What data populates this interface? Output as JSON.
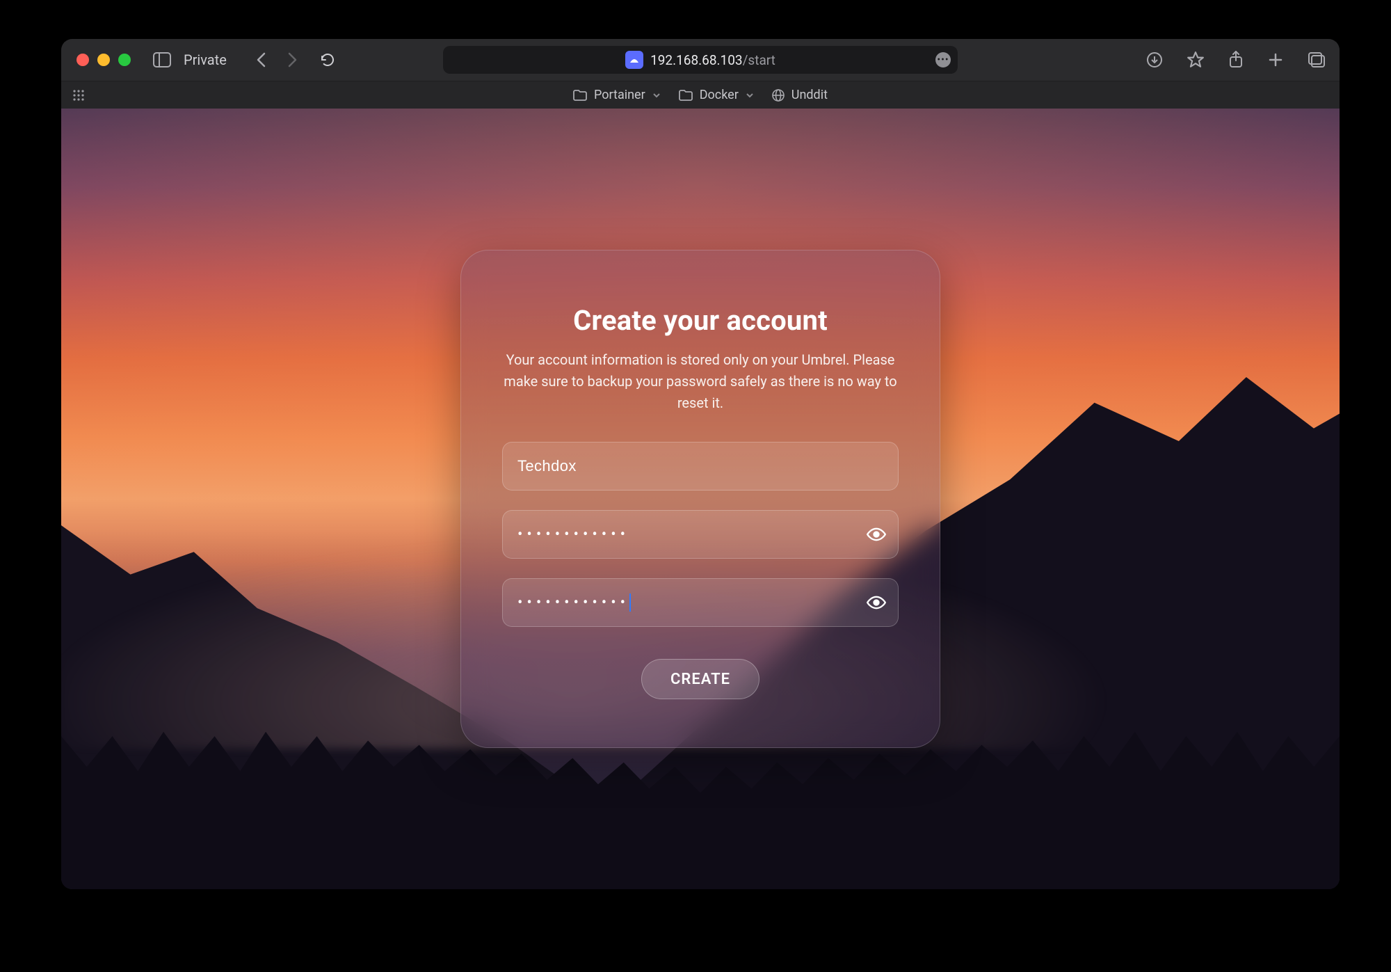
{
  "browser": {
    "private_label": "Private",
    "url_host": "192.168.68.103",
    "url_path": "/start",
    "bookmarks": [
      {
        "label": "Portainer",
        "icon": "folder-icon"
      },
      {
        "label": "Docker",
        "icon": "folder-icon"
      },
      {
        "label": "Unddit",
        "icon": "globe-icon"
      }
    ]
  },
  "card": {
    "title": "Create your account",
    "subtitle": "Your account information is stored only on your Umbrel. Please make sure to backup your password safely as there is no way to reset it.",
    "name_value": "Techdox",
    "password_mask": "••••••••••••",
    "confirm_mask": "••••••••••••",
    "create_label": "CREATE"
  }
}
